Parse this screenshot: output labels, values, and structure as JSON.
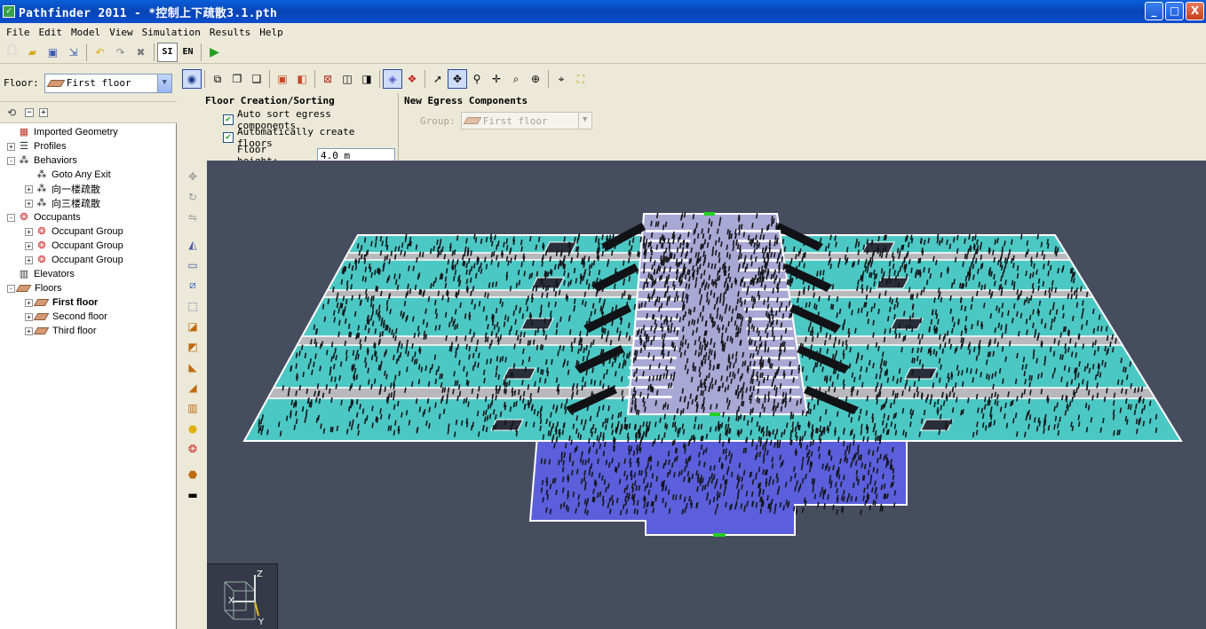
{
  "window": {
    "title": "Pathfinder 2011 - *控制上下疏散3.1.pth",
    "app_icon": "pathfinder-icon",
    "buttons": {
      "minimize": "_",
      "maximize": "□",
      "close": "X"
    }
  },
  "menu": [
    "File",
    "Edit",
    "Model",
    "View",
    "Simulation",
    "Results",
    "Help"
  ],
  "toolbar": {
    "si_label": "SI",
    "en_label": "EN"
  },
  "floor_selector": {
    "label": "Floor:",
    "value": "First floor"
  },
  "tree": {
    "items": [
      {
        "label": "Imported Geometry",
        "icon": "geometry-icon",
        "expander": "",
        "indent": 0
      },
      {
        "label": "Profiles",
        "icon": "profile-list-icon",
        "expander": "+",
        "indent": 0
      },
      {
        "label": "Behaviors",
        "icon": "footsteps-icon",
        "expander": "-",
        "indent": 0
      },
      {
        "label": "Goto Any Exit",
        "icon": "footsteps-icon",
        "expander": "",
        "indent": 1
      },
      {
        "label": "向一楼疏散",
        "icon": "footsteps-icon",
        "expander": "+",
        "indent": 1
      },
      {
        "label": "向三楼疏散",
        "icon": "footsteps-icon",
        "expander": "+",
        "indent": 1
      },
      {
        "label": "Occupants",
        "icon": "occupants-icon",
        "expander": "-",
        "indent": 0
      },
      {
        "label": "Occupant Group",
        "icon": "occupants-icon",
        "expander": "+",
        "indent": 1
      },
      {
        "label": "Occupant Group",
        "icon": "occupants-icon",
        "expander": "+",
        "indent": 1
      },
      {
        "label": "Occupant Group",
        "icon": "occupants-icon",
        "expander": "+",
        "indent": 1
      },
      {
        "label": "Elevators",
        "icon": "elevator-icon",
        "expander": "",
        "indent": 0
      },
      {
        "label": "Floors",
        "icon": "floor-icon",
        "expander": "-",
        "indent": 0
      },
      {
        "label": "First floor",
        "icon": "floor-icon",
        "expander": "+",
        "indent": 1,
        "bold": true
      },
      {
        "label": "Second floor",
        "icon": "floor-icon",
        "expander": "+",
        "indent": 1
      },
      {
        "label": "Third floor",
        "icon": "floor-icon",
        "expander": "+",
        "indent": 1
      }
    ]
  },
  "floor_creation": {
    "title": "Floor Creation/Sorting",
    "auto_sort_label": "Auto sort egress components",
    "auto_sort_checked": true,
    "auto_create_label": "Automatically create floors",
    "auto_create_checked": true,
    "floor_height_label": "Floor height:",
    "floor_height_value": "4.0 m"
  },
  "egress": {
    "title": "New Egress Components",
    "group_label": "Group:",
    "group_value": "First floor"
  },
  "axes": {
    "z": "Z",
    "x": "X",
    "y": "Y"
  },
  "colors": {
    "viewport_bg": "#464d5e",
    "floor_teal": "#4cc8c4",
    "aisle_gray": "#b9b9bd",
    "stair_lavender": "#a9a7d4",
    "lower_floor_blue": "#5b5fdc",
    "exit_green": "#22d022"
  }
}
